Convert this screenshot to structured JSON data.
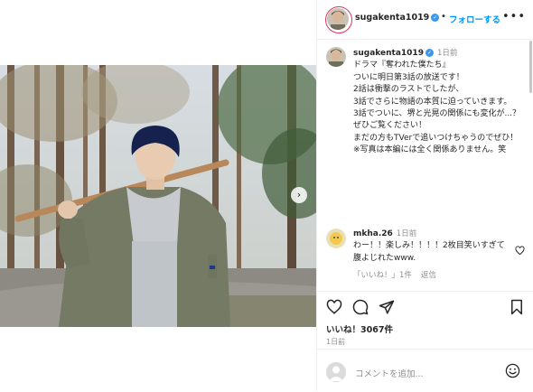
{
  "post": {
    "username": "sugakenta1019",
    "follow_label": "フォローする",
    "dot": "•",
    "more": "•••"
  },
  "caption": {
    "username": "sugakenta1019",
    "time": "1日前",
    "lines": [
      "ドラマ『奪われた僕たち』",
      "ついに明日第3話の放送です！",
      "2話は衝撃のラストでしたが、",
      "3話でさらに物語の本質に迫っていきます。",
      "3話でついに、堺と光晃の関係にも変化が...？",
      "ぜひご覧ください！",
      "まだの方もTVerで追いつけちゃうのでぜひ！",
      "",
      "※写真は本編には全く関係ありません。笑"
    ]
  },
  "reply": {
    "username": "mkha.26",
    "time": "1日前",
    "text": "わー！！楽しみ！！！！2枚目笑いすぎて腹よじれたwww.",
    "likes_label": "「いいね！」1件",
    "reply_label": "返信"
  },
  "likes": "いいね！3067件",
  "ago": "1日前",
  "comment_placeholder": "コメントを追加...",
  "icons": {
    "heart": "heart-icon",
    "comment": "comment-icon",
    "share": "paper-plane-icon",
    "save": "bookmark-icon",
    "emoji": "smiley-icon",
    "next": "chevron-right-icon"
  },
  "colors": {
    "link": "#0095f6",
    "verified": "#3897f0",
    "border": "#efefef",
    "muted": "#8e8e8e"
  }
}
